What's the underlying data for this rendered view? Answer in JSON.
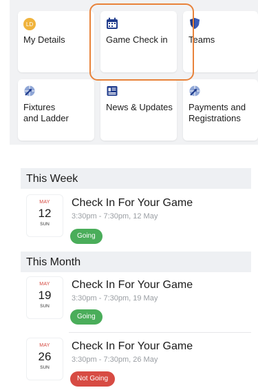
{
  "tiles": [
    {
      "label": "My Details",
      "icon": "avatar-initials",
      "initials": "LD"
    },
    {
      "label": "Game Check in",
      "icon": "calendar-icon"
    },
    {
      "label": "Teams",
      "icon": "shield-icon"
    },
    {
      "label": "Fixtures\nand Ladder",
      "icon": "globe-arrow-icon"
    },
    {
      "label": "News & Updates",
      "icon": "news-icon"
    },
    {
      "label": "Payments and\nRegistrations",
      "icon": "globe-arrow-icon"
    }
  ],
  "sections": [
    {
      "heading": "This Week",
      "events": [
        {
          "month": "MAY",
          "day": "12",
          "weekday": "SUN",
          "title": "Check In For Your Game",
          "time": "3:30pm - 7:30pm, 12 May",
          "status": "Going"
        }
      ]
    },
    {
      "heading": "This Month",
      "events": [
        {
          "month": "MAY",
          "day": "19",
          "weekday": "SUN",
          "title": "Check In For Your Game",
          "time": "3:30pm - 7:30pm, 19 May",
          "status": "Going"
        },
        {
          "month": "MAY",
          "day": "26",
          "weekday": "SUN",
          "title": "Check In For Your Game",
          "time": "3:30pm - 7:30pm, 26 May",
          "status": "Not Going"
        }
      ]
    }
  ],
  "colors": {
    "highlight": "#e8823a",
    "going": "#4aad5a",
    "not_going": "#d74b43",
    "accent": "#1f3b8c"
  }
}
